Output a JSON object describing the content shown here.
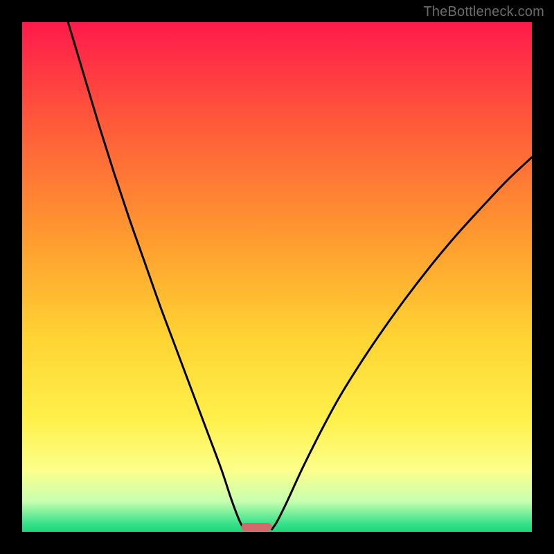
{
  "watermark": "TheBottleneck.com",
  "chart_data": {
    "type": "line",
    "title": "",
    "xlabel": "",
    "ylabel": "",
    "xlim": [
      0,
      100
    ],
    "ylim": [
      0,
      100
    ],
    "grid": false,
    "legend": false,
    "background": {
      "type": "vertical-gradient",
      "stops": [
        {
          "offset": 0.0,
          "color": "#ff1a4b"
        },
        {
          "offset": 0.2,
          "color": "#ff5a3a"
        },
        {
          "offset": 0.42,
          "color": "#ff9a2f"
        },
        {
          "offset": 0.62,
          "color": "#ffd433"
        },
        {
          "offset": 0.78,
          "color": "#fff04b"
        },
        {
          "offset": 0.88,
          "color": "#fbff8a"
        },
        {
          "offset": 0.94,
          "color": "#c8ffb0"
        },
        {
          "offset": 0.985,
          "color": "#35e08a"
        },
        {
          "offset": 1.0,
          "color": "#1ed67a"
        }
      ]
    },
    "series": [
      {
        "name": "left-curve",
        "x": [
          9.0,
          12.0,
          15.0,
          18.0,
          21.0,
          24.0,
          27.0,
          30.0,
          33.0,
          36.0,
          39.0,
          41.0,
          42.5,
          43.5
        ],
        "y": [
          100.0,
          90.0,
          80.0,
          70.5,
          61.5,
          53.0,
          44.5,
          36.5,
          28.5,
          20.5,
          12.5,
          6.5,
          2.5,
          0.5
        ]
      },
      {
        "name": "right-curve",
        "x": [
          49.0,
          50.0,
          52.0,
          55.0,
          58.5,
          62.0,
          66.0,
          70.0,
          75.0,
          80.0,
          85.0,
          90.0,
          95.0,
          100.0
        ],
        "y": [
          0.5,
          2.0,
          6.0,
          12.5,
          19.5,
          26.0,
          32.5,
          38.5,
          45.5,
          52.0,
          58.0,
          63.5,
          68.8,
          73.5
        ]
      }
    ],
    "marker": {
      "name": "bottleneck-marker",
      "x_center": 46.0,
      "width": 6.0,
      "color": "#d16a6a"
    }
  }
}
